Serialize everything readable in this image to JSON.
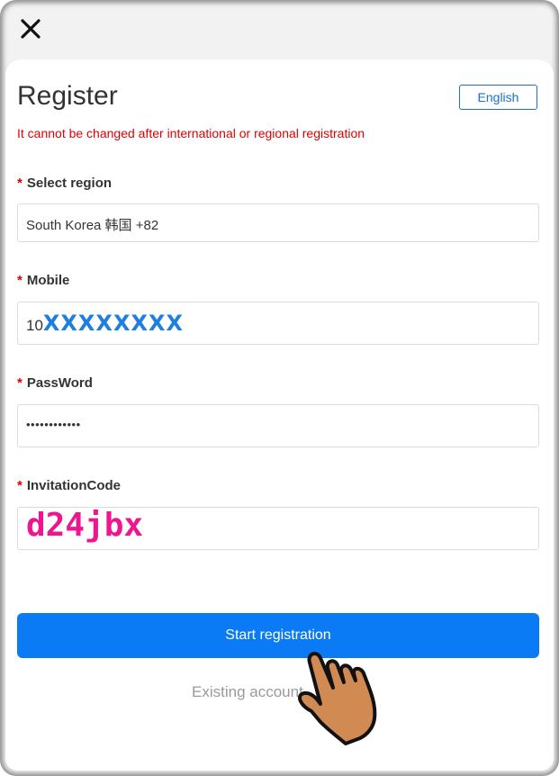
{
  "topbar": {
    "close_icon": "close-icon"
  },
  "header": {
    "title": "Register",
    "language_button": "English",
    "warning": "It cannot be changed after international or regional registration"
  },
  "form": {
    "required_mark": "*",
    "region": {
      "label": "Select region",
      "value": "South Korea 韩国 +82"
    },
    "mobile": {
      "label": "Mobile",
      "prefix": "10",
      "masked": "XXXXXXXX"
    },
    "password": {
      "label": "PassWord",
      "value": "••••••••••••"
    },
    "invitation": {
      "label": "InvitationCode",
      "value": "d24jbx"
    }
  },
  "actions": {
    "submit_label": "Start registration",
    "existing_account": "Existing account"
  },
  "colors": {
    "accent": "#0a7bf5",
    "warning": "#e00000",
    "mobile_mask": "#1e7fe0",
    "invite_code": "#ee1690",
    "hand_skin": "#d08a52"
  },
  "overlay": {
    "icon": "pointing-hand-icon"
  }
}
